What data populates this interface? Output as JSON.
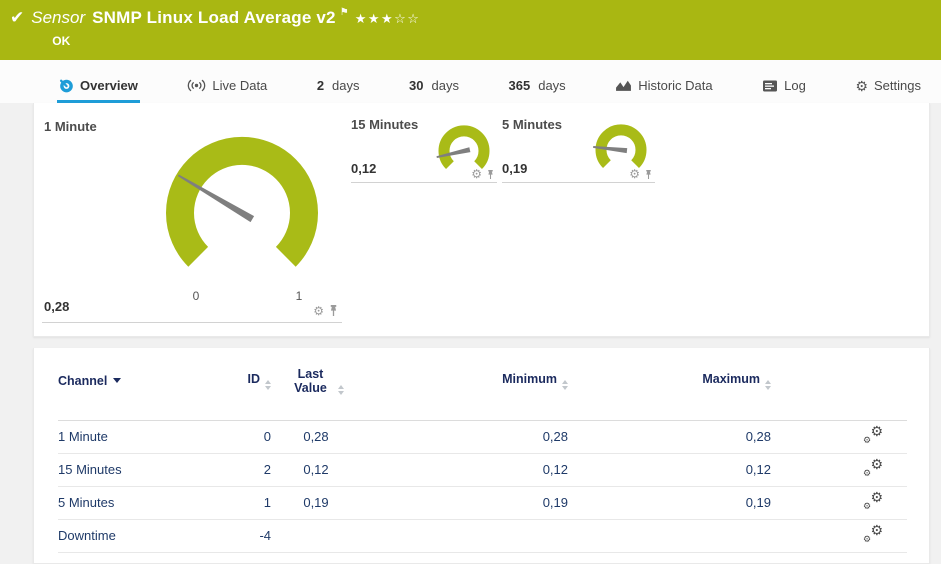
{
  "colors": {
    "brand_green": "#a9b712",
    "gauge_green": "#a9bb17",
    "accent_blue": "#1e9dd8",
    "header_navy": "#1b2a5e",
    "value_navy": "#1f3a68"
  },
  "header": {
    "kind_label": "Sensor",
    "title": "SNMP Linux Load Average v2",
    "status_text": "OK",
    "rating_filled": 3,
    "rating_total": 5
  },
  "tabs": [
    {
      "id": "overview",
      "icon": "gauge-icon",
      "label": "Overview",
      "active": true
    },
    {
      "id": "live-data",
      "icon": "live-icon",
      "label": "Live Data"
    },
    {
      "id": "2-days",
      "bold": "2",
      "label": "days"
    },
    {
      "id": "30-days",
      "bold": "30",
      "label": "days"
    },
    {
      "id": "365-days",
      "bold": "365",
      "label": "days"
    },
    {
      "id": "historic-data",
      "icon": "chart-icon",
      "label": "Historic Data"
    },
    {
      "id": "log",
      "icon": "log-icon",
      "label": "Log"
    },
    {
      "id": "settings",
      "icon": "gear-icon",
      "label": "Settings"
    }
  ],
  "gauges": [
    {
      "name": "1 Minute",
      "value": 0.28,
      "value_label": "0,28",
      "min": 0,
      "max": 1,
      "scale_min_label": "0",
      "scale_max_label": "1",
      "size": "large"
    },
    {
      "name": "15 Minutes",
      "value": 0.12,
      "value_label": "0,12",
      "min": 0,
      "max": 1,
      "size": "small"
    },
    {
      "name": "5 Minutes",
      "value": 0.19,
      "value_label": "0,19",
      "min": 0,
      "max": 1,
      "size": "small"
    }
  ],
  "table": {
    "columns": [
      {
        "key": "channel",
        "label": "Channel",
        "sort": "desc",
        "align": "left"
      },
      {
        "key": "id",
        "label": "ID",
        "sort": "none",
        "align": "right"
      },
      {
        "key": "last_value",
        "label": "Last Value",
        "sort": "none",
        "align": "center"
      },
      {
        "key": "minimum",
        "label": "Minimum",
        "sort": "none",
        "align": "right"
      },
      {
        "key": "maximum",
        "label": "Maximum",
        "sort": "none",
        "align": "right"
      },
      {
        "key": "settings",
        "label": "",
        "sort": null,
        "align": "right"
      }
    ],
    "rows": [
      {
        "channel": "1 Minute",
        "id": "0",
        "last_value": "0,28",
        "minimum": "0,28",
        "maximum": "0,28"
      },
      {
        "channel": "15 Minutes",
        "id": "2",
        "last_value": "0,12",
        "minimum": "0,12",
        "maximum": "0,12"
      },
      {
        "channel": "5 Minutes",
        "id": "1",
        "last_value": "0,19",
        "minimum": "0,19",
        "maximum": "0,19"
      },
      {
        "channel": "Downtime",
        "id": "-4",
        "last_value": "",
        "minimum": "",
        "maximum": ""
      }
    ]
  }
}
